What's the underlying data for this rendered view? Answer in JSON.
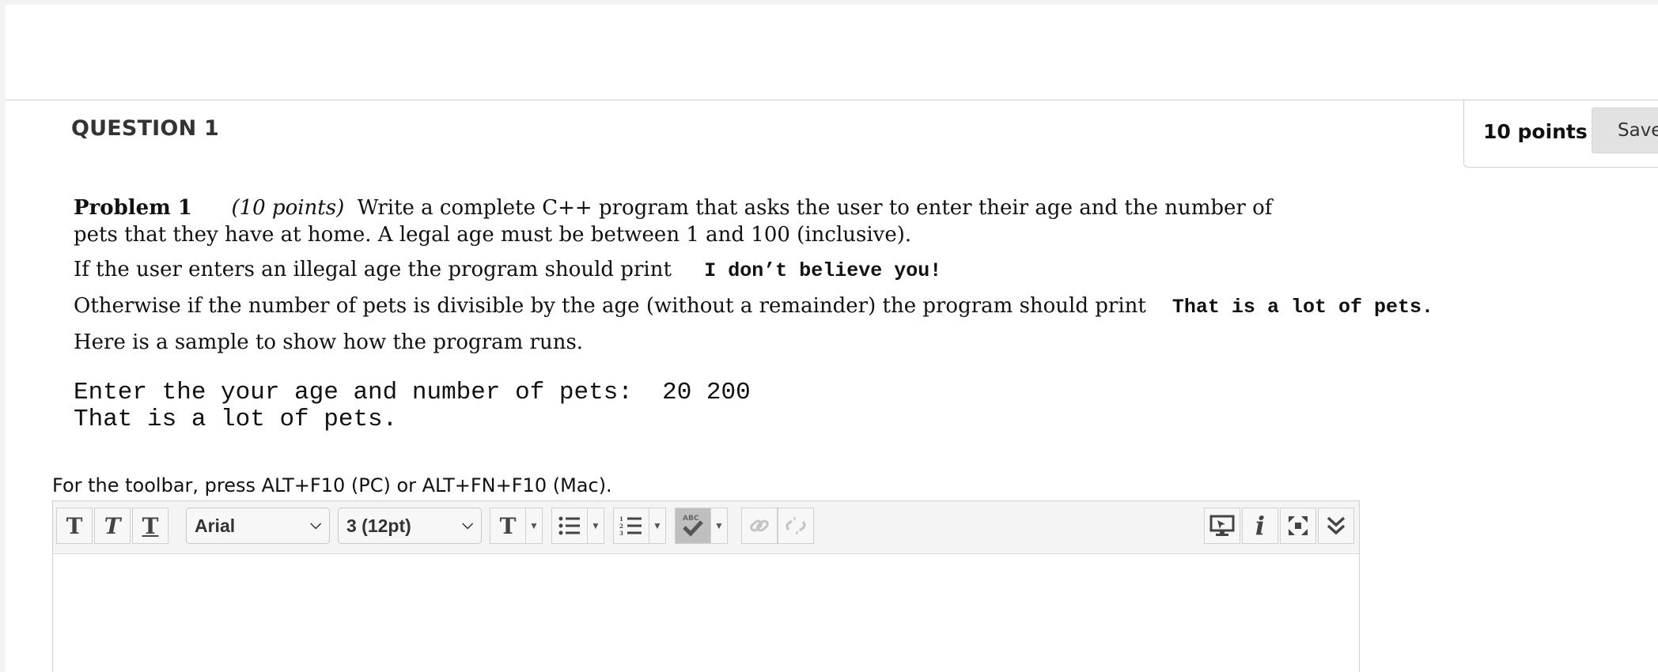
{
  "question": {
    "title": "QUESTION 1",
    "points": "10 points",
    "save_label": "Save"
  },
  "problem": {
    "heading": "Problem 1",
    "points_note": "(10 points)",
    "intro_line1": "Write a complete C++ program that asks the user to enter their age and the number of",
    "intro_line2": "pets that they have at home. A legal age must be between 1 and 100 (inclusive).",
    "illegal_text": "If the user enters an illegal age the program should print",
    "illegal_output": "I don’t believe you!",
    "divisible_text": "Otherwise if the number of pets is divisible by the age (without a remainder) the program should print",
    "divisible_output": "That is a lot of pets.",
    "sample_intro": "Here is a sample to show how the program runs.",
    "sample_line1": "Enter the your age and number of pets:  20 200",
    "sample_line2": "That is a lot of pets."
  },
  "editor": {
    "toolbar_hint": "For the toolbar, press ALT+F10 (PC) or ALT+FN+F10 (Mac).",
    "font_family": "Arial",
    "font_size": "3 (12pt)",
    "icons": [
      "bold-icon",
      "italic-icon",
      "underline-icon",
      "text-color-icon",
      "bullet-list-icon",
      "numbered-list-icon",
      "spellcheck-icon",
      "link-icon",
      "unlink-icon",
      "preview-icon",
      "info-icon",
      "fullscreen-icon",
      "expand-toolbar-icon"
    ],
    "spell_label": "ABC"
  }
}
